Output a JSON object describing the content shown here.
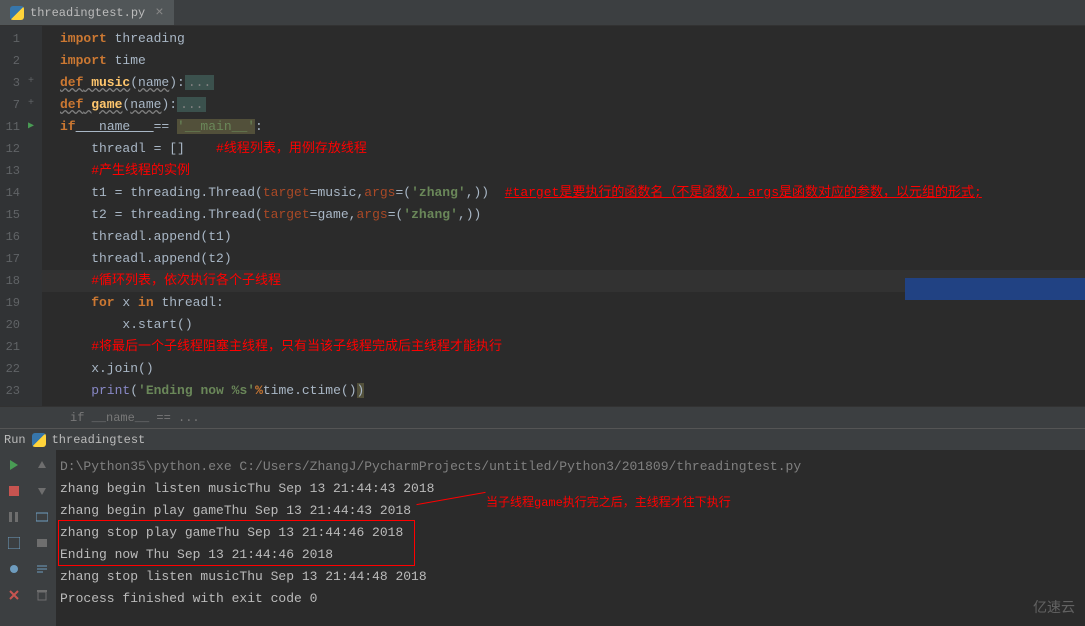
{
  "tab": {
    "filename": "threadingtest.py",
    "close": "×"
  },
  "gutter_lines": [
    "1",
    "2",
    "3",
    "7",
    "11",
    "12",
    "13",
    "14",
    "15",
    "16",
    "17",
    "18",
    "19",
    "20",
    "21",
    "22",
    "23"
  ],
  "code": {
    "l1_import": "import",
    "l1_mod": " threading",
    "l2_import": "import",
    "l2_mod": " time",
    "l3_def": "def",
    "l3_fn": " music",
    "l3_paren_open": "(",
    "l3_param": "name",
    "l3_paren_close": "):",
    "l3_dots": "...",
    "l7_def": "def",
    "l7_fn": " game",
    "l7_paren_open": "(",
    "l7_param": "name",
    "l7_paren_close": "):",
    "l7_dots": "...",
    "l11_if": "if",
    "l11_name": " __name__ ",
    "l11_eq": "== ",
    "l11_str": "'__main__'",
    "l11_colon": ":",
    "l12_var": "    threadl ",
    "l12_eq": "= ",
    "l12_val": "[]",
    "l12_cmt": "    #线程列表，用例存放线程",
    "l13_cmt": "    #产生线程的实例",
    "l14_a": "    t1 ",
    "l14_eq": "= ",
    "l14_b": "threading.Thread(",
    "l14_target": "target",
    "l14_c": "=music,",
    "l14_args": "args",
    "l14_d": "=(",
    "l14_str": "'zhang'",
    "l14_e": ",))  ",
    "l14_cmt": "#target是要执行的函数名（不是函数），args是函数对应的参数，以元组的形式;",
    "l15_a": "    t2 ",
    "l15_eq": "= ",
    "l15_b": "threading.Thread(",
    "l15_target": "target",
    "l15_c": "=game,",
    "l15_args": "args",
    "l15_d": "=(",
    "l15_str": "'zhang'",
    "l15_e": ",))",
    "l16": "    threadl.append(t1)",
    "l17": "    threadl.append(t2)",
    "l18_cmt": "    #循环列表，依次执行各个子线程",
    "l19_for": "    for ",
    "l19_x": "x ",
    "l19_in": "in ",
    "l19_list": "threadl:",
    "l20": "        x.start()",
    "l21_cmt": "    #将最后一个子线程阻塞主线程，只有当该子线程完成后主线程才能执行",
    "l22": "    x.join()",
    "l23_print": "    print",
    "l23_a": "(",
    "l23_str": "'Ending now %s'",
    "l23_pct": "%",
    "l23_b": "time.ctime()",
    "l23_c": ")"
  },
  "breadcrumb": "if __name__ == ...",
  "run": {
    "label": "Run",
    "config": "threadingtest"
  },
  "console": {
    "cmd": "D:\\Python35\\python.exe C:/Users/ZhangJ/PycharmProjects/untitled/Python3/201809/threadingtest.py",
    "l1": "zhang begin listen musicThu Sep 13 21:44:43 2018",
    "l2": "zhang begin play gameThu Sep 13 21:44:43 2018",
    "l3": "zhang stop play gameThu Sep 13 21:44:46 2018",
    "l4": "Ending now Thu Sep 13 21:44:46 2018",
    "l5": "zhang stop listen musicThu Sep 13 21:44:48 2018",
    "l6": "",
    "l7": "Process finished with exit code 0",
    "annotation": "当子线程game执行完之后，主线程才往下执行"
  },
  "watermark": "亿速云"
}
